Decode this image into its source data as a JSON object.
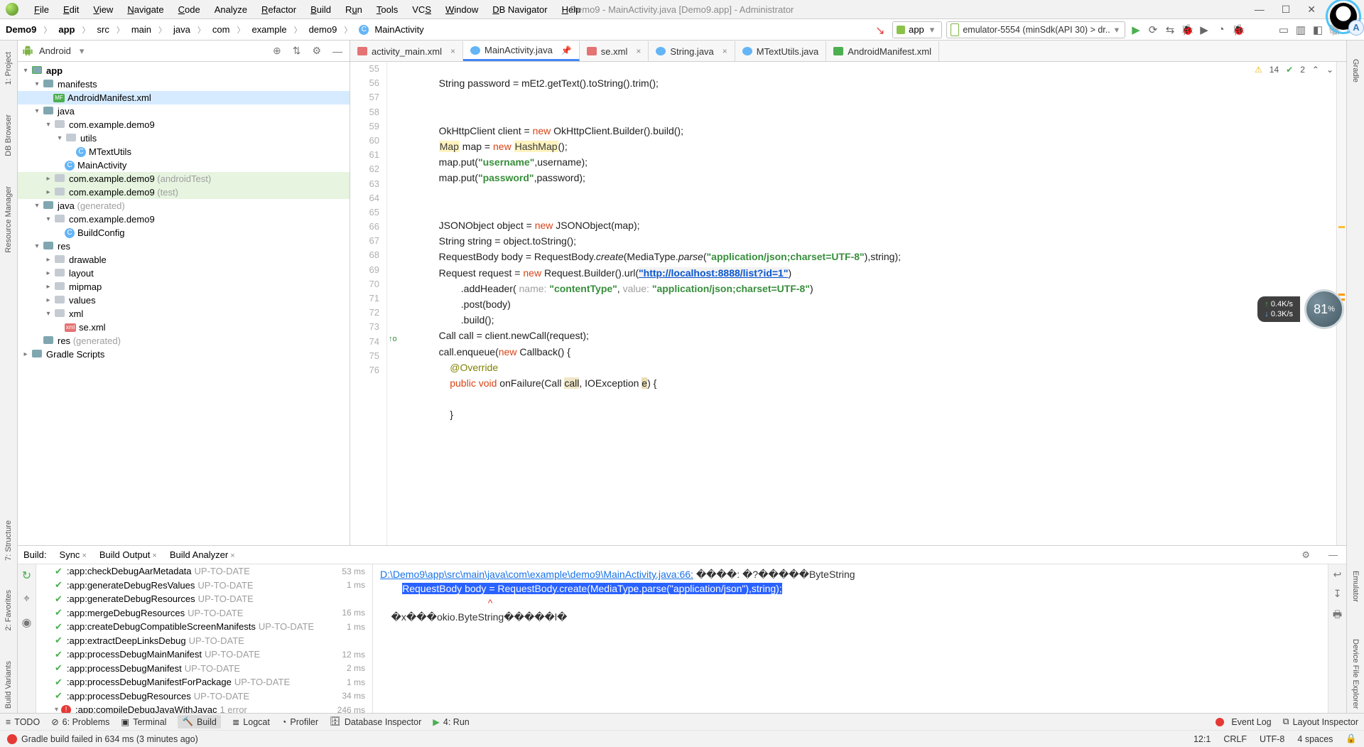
{
  "window": {
    "title": "Demo9 - MainActivity.java [Demo9.app] - Administrator"
  },
  "menu": {
    "file": "File",
    "edit": "Edit",
    "view": "View",
    "navigate": "Navigate",
    "code": "Code",
    "analyze": "Analyze",
    "refactor": "Refactor",
    "build": "Build",
    "run": "Run",
    "tools": "Tools",
    "vcs": "VCS",
    "window": "Window",
    "dbnav": "DB Navigator",
    "help": "Help"
  },
  "avatar_badge": "A",
  "breadcrumb": {
    "b0": "Demo9",
    "b1": "app",
    "b2": "src",
    "b3": "main",
    "b4": "java",
    "b5": "com",
    "b6": "example",
    "b7": "demo9",
    "b8": "MainActivity"
  },
  "run_config": {
    "label": "app"
  },
  "device": {
    "label": "emulator-5554 (minSdk(API 30) > dr.."
  },
  "project": {
    "view": "Android",
    "app": "app",
    "manifests": "manifests",
    "android_manifest": "AndroidManifest.xml",
    "java": "java",
    "pkg_main": "com.example.demo9",
    "utils": "utils",
    "mtext": "MTextUtils",
    "main_act": "MainActivity",
    "pkg_at": "com.example.demo9",
    "pkg_at_suffix": "(androidTest)",
    "pkg_test": "com.example.demo9",
    "pkg_test_suffix": "(test)",
    "java_gen": "java",
    "java_gen_suffix": "(generated)",
    "pkg_gen": "com.example.demo9",
    "buildconfig": "BuildConfig",
    "res": "res",
    "drawable": "drawable",
    "layout": "layout",
    "mipmap": "mipmap",
    "values": "values",
    "xml": "xml",
    "se_xml": "se.xml",
    "res_gen": "res",
    "res_gen_suffix": "(generated)",
    "gradle_scripts": "Gradle Scripts"
  },
  "tabs": {
    "t0": "activity_main.xml",
    "t1": "MainActivity.java",
    "t2": "se.xml",
    "t3": "String.java",
    "t4": "MTextUtils.java",
    "t5": "AndroidManifest.xml"
  },
  "editor": {
    "warnings": "14",
    "typos": "2",
    "lines": {
      "l55": "            String password = mEt2.getText().toString().trim();",
      "l56": "",
      "l57": "",
      "l58_a": "            OkHttpClient client = ",
      "l58_b": "new",
      "l58_c": " OkHttpClient.Builder().build();",
      "l59_a": "            ",
      "l59_b": "Map",
      "l59_c": " map = ",
      "l59_d": "new",
      "l59_e": " ",
      "l59_f": "HashMap",
      "l59_g": "();",
      "l60_a": "            map.put(",
      "l60_b": "\"username\"",
      "l60_c": ",username);",
      "l61_a": "            map.put(",
      "l61_b": "\"password\"",
      "l61_c": ",password);",
      "l62": "",
      "l63": "",
      "l64_a": "            JSONObject object = ",
      "l64_b": "new",
      "l64_c": " JSONObject(map);",
      "l65": "            String string = object.toString();",
      "l66_a": "            RequestBody body = RequestBody.",
      "l66_b": "create",
      "l66_c": "(MediaType.",
      "l66_d": "parse",
      "l66_e": "(",
      "l66_f": "\"application/json;charset=UTF-8\"",
      "l66_g": "),string);",
      "l67_a": "            Request request = ",
      "l67_b": "new",
      "l67_c": " Request.Builder().url(",
      "l67_d": "\"http://localhost:8888/list?id=1\"",
      "l67_e": ")",
      "l68_a": "                    .addHeader( ",
      "l68_b": "name: ",
      "l68_c": "\"contentType\"",
      "l68_d": ", ",
      "l68_e": "value: ",
      "l68_f": "\"application/json;charset=UTF-8\"",
      "l68_g": ")",
      "l69": "                    .post(body)",
      "l70": "                    .build();",
      "l71": "            Call call = client.newCall(request);",
      "l72_a": "            call.enqueue(",
      "l72_b": "new",
      "l72_c": " Callback() {",
      "l73_a": "                ",
      "l73_b": "@Override",
      "l74_a": "                ",
      "l74_b": "public",
      "l74_c": " ",
      "l74_d": "void",
      "l74_e": " onFailure(Call ",
      "l74_f": "call",
      "l74_g": ", IOException ",
      "l74_h": "e",
      "l74_i": ") {",
      "l75": "",
      "l76": "                }"
    },
    "gutter": [
      "55",
      "56",
      "57",
      "58",
      "59",
      "60",
      "61",
      "62",
      "63",
      "64",
      "65",
      "66",
      "67",
      "68",
      "69",
      "70",
      "71",
      "72",
      "73",
      "74",
      "75",
      "76"
    ]
  },
  "build": {
    "label": "Build:",
    "sync": "Sync",
    "output": "Build Output",
    "analyzer": "Build Analyzer",
    "tasks": [
      {
        "name": ":app:checkDebugAarMetadata",
        "state": "UP-TO-DATE",
        "time": "53 ms",
        "ok": true
      },
      {
        "name": ":app:generateDebugResValues",
        "state": "UP-TO-DATE",
        "time": "1 ms",
        "ok": true
      },
      {
        "name": ":app:generateDebugResources",
        "state": "UP-TO-DATE",
        "time": "",
        "ok": true
      },
      {
        "name": ":app:mergeDebugResources",
        "state": "UP-TO-DATE",
        "time": "16 ms",
        "ok": true
      },
      {
        "name": ":app:createDebugCompatibleScreenManifests",
        "state": "UP-TO-DATE",
        "time": "1 ms",
        "ok": true
      },
      {
        "name": ":app:extractDeepLinksDebug",
        "state": "UP-TO-DATE",
        "time": "",
        "ok": true
      },
      {
        "name": ":app:processDebugMainManifest",
        "state": "UP-TO-DATE",
        "time": "12 ms",
        "ok": true
      },
      {
        "name": ":app:processDebugManifest",
        "state": "UP-TO-DATE",
        "time": "2 ms",
        "ok": true
      },
      {
        "name": ":app:processDebugManifestForPackage",
        "state": "UP-TO-DATE",
        "time": "1 ms",
        "ok": true
      },
      {
        "name": ":app:processDebugResources",
        "state": "UP-TO-DATE",
        "time": "34 ms",
        "ok": true
      },
      {
        "name": ":app:compileDebugJavaWithJavac",
        "state": "1 error",
        "time": "246 ms",
        "ok": false
      }
    ],
    "out_path": "D:\\Demo9\\app\\src\\main\\java\\com\\example\\demo9\\MainActivity.java:66:",
    "out_tail": " ����: �?�����ByteString",
    "out_sel": "RequestBody body = RequestBody.create(MediaType.parse(\"application/json\"),string);",
    "out_caret": "                                       ^",
    "out_l3": "    �x���okio.ByteString�����l�"
  },
  "perf": {
    "up": "0.4K/s",
    "down": "0.3K/s",
    "pct": "81",
    "pct_suffix": "%"
  },
  "bottom": {
    "todo": "TODO",
    "problems": "6: Problems",
    "terminal": "Terminal",
    "build": "Build",
    "logcat": "Logcat",
    "profiler": "Profiler",
    "dbi": "Database Inspector",
    "run": "4: Run",
    "event": "Event Log",
    "layout": "Layout Inspector"
  },
  "left_rail": {
    "project": "1: Project",
    "db": "DB Browser",
    "res": "Resource Manager",
    "struct": "7: Structure",
    "fav": "2: Favorites",
    "bv": "Build Variants"
  },
  "right_rail": {
    "gradle": "Gradle",
    "emu": "Emulator",
    "dev": "Device File Explorer"
  },
  "status": {
    "msg": "Gradle build failed in 634 ms (3 minutes ago)",
    "pos": "12:1",
    "crlf": "CRLF",
    "enc": "UTF-8",
    "indent": "4 spaces"
  }
}
